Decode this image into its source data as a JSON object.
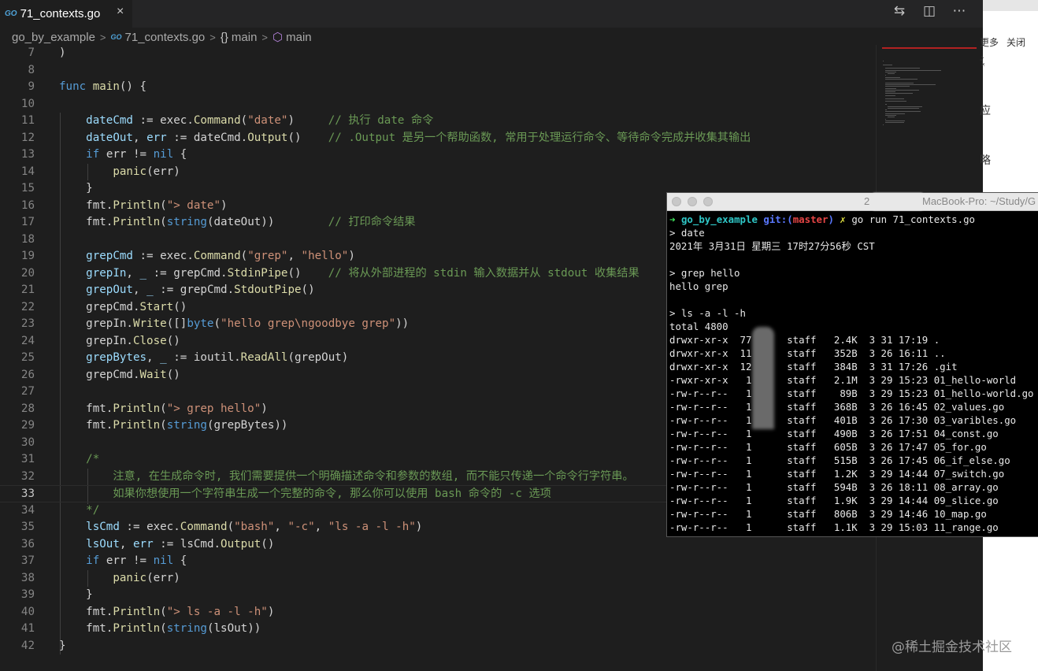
{
  "tab": {
    "badge": "GO",
    "title": "71_contexts.go",
    "close": "×"
  },
  "tab_actions": {
    "compare": "⇆",
    "split": "◫",
    "more": "⋯"
  },
  "breadcrumb": {
    "folder": "go_by_example",
    "badge": "GO",
    "file": "71_contexts.go",
    "braces": "{}",
    "scope": "main",
    "symbol": "main"
  },
  "code_lines": [
    {
      "n": "7",
      "t": ")"
    },
    {
      "n": "8",
      "t": ""
    },
    {
      "n": "9",
      "t": "func main() {"
    },
    {
      "n": "10",
      "t": ""
    },
    {
      "n": "11",
      "t": "    dateCmd := exec.Command(\"date\")     // 执行 date 命令"
    },
    {
      "n": "12",
      "t": "    dateOut, err := dateCmd.Output()    // .Output 是另一个帮助函数, 常用于处理运行命令、等待命令完成并收集其输出"
    },
    {
      "n": "13",
      "t": "    if err != nil {"
    },
    {
      "n": "14",
      "t": "        panic(err)"
    },
    {
      "n": "15",
      "t": "    }"
    },
    {
      "n": "16",
      "t": "    fmt.Println(\"> date\")"
    },
    {
      "n": "17",
      "t": "    fmt.Println(string(dateOut))        // 打印命令结果"
    },
    {
      "n": "18",
      "t": ""
    },
    {
      "n": "19",
      "t": "    grepCmd := exec.Command(\"grep\", \"hello\")"
    },
    {
      "n": "20",
      "t": "    grepIn, _ := grepCmd.StdinPipe()    // 将从外部进程的 stdin 输入数据并从 stdout 收集结果"
    },
    {
      "n": "21",
      "t": "    grepOut, _ := grepCmd.StdoutPipe()"
    },
    {
      "n": "22",
      "t": "    grepCmd.Start()"
    },
    {
      "n": "23",
      "t": "    grepIn.Write([]byte(\"hello grep\\ngoodbye grep\"))"
    },
    {
      "n": "24",
      "t": "    grepIn.Close()"
    },
    {
      "n": "25",
      "t": "    grepBytes, _ := ioutil.ReadAll(grepOut)"
    },
    {
      "n": "26",
      "t": "    grepCmd.Wait()"
    },
    {
      "n": "27",
      "t": ""
    },
    {
      "n": "28",
      "t": "    fmt.Println(\"> grep hello\")"
    },
    {
      "n": "29",
      "t": "    fmt.Println(string(grepBytes))"
    },
    {
      "n": "30",
      "t": ""
    },
    {
      "n": "31",
      "t": "    /*"
    },
    {
      "n": "32",
      "t": "        注意, 在生成命令时, 我们需要提供一个明确描述命令和参数的数组, 而不能只传递一个命令行字符串。"
    },
    {
      "n": "33",
      "t": "        如果你想使用一个字符串生成一个完整的命令, 那么你可以使用 bash 命令的 -c 选项"
    },
    {
      "n": "34",
      "t": "    */"
    },
    {
      "n": "35",
      "t": "    lsCmd := exec.Command(\"bash\", \"-c\", \"ls -a -l -h\")"
    },
    {
      "n": "36",
      "t": "    lsOut, err := lsCmd.Output()"
    },
    {
      "n": "37",
      "t": "    if err != nil {"
    },
    {
      "n": "38",
      "t": "        panic(err)"
    },
    {
      "n": "39",
      "t": "    }"
    },
    {
      "n": "40",
      "t": "    fmt.Println(\"> ls -a -l -h\")"
    },
    {
      "n": "41",
      "t": "    fmt.Println(string(lsOut))"
    },
    {
      "n": "42",
      "t": "}"
    }
  ],
  "current_line": "33",
  "right_panel": {
    "more": "更多",
    "close": "关闭",
    "glyph1": "应",
    "glyph2": "略",
    "glyph0": "认"
  },
  "terminal": {
    "title": "MacBook-Pro: ~/Study/G",
    "title_prefix": "2",
    "prompt_arrow": "➜",
    "prompt_dir": "go_by_example",
    "prompt_git": "git:(",
    "prompt_branch": "master",
    "prompt_git_close": ")",
    "prompt_x": "✗",
    "prompt_cmd": "go run 71_contexts.go",
    "lines": [
      "> date",
      "2021年 3月31日 星期三 17时27分56秒 CST",
      "",
      "> grep hello",
      "hello grep",
      "",
      "> ls -a -l -h",
      "total 4800",
      "drwxr-xr-x  77      staff   2.4K  3 31 17:19 .",
      "drwxr-xr-x  11      staff   352B  3 26 16:11 ..",
      "drwxr-xr-x  12      staff   384B  3 31 17:26 .git",
      "-rwxr-xr-x   1      staff   2.1M  3 29 15:23 01_hello-world",
      "-rw-r--r--   1      staff    89B  3 29 15:23 01_hello-world.go",
      "-rw-r--r--   1      staff   368B  3 26 16:45 02_values.go",
      "-rw-r--r--   1      staff   401B  3 26 17:30 03_varibles.go",
      "-rw-r--r--   1      staff   490B  3 26 17:51 04_const.go",
      "-rw-r--r--   1      staff   605B  3 26 17:47 05_for.go",
      "-rw-r--r--   1      staff   515B  3 26 17:45 06_if_else.go",
      "-rw-r--r--   1      staff   1.2K  3 29 14:44 07_switch.go",
      "-rw-r--r--   1      staff   594B  3 26 18:11 08_array.go",
      "-rw-r--r--   1      staff   1.9K  3 29 14:44 09_slice.go",
      "-rw-r--r--   1      staff   806B  3 29 14:46 10_map.go",
      "-rw-r--r--   1      staff   1.1K  3 29 15:03 11_range.go"
    ]
  },
  "watermark": "@稀土掘金技术社区"
}
